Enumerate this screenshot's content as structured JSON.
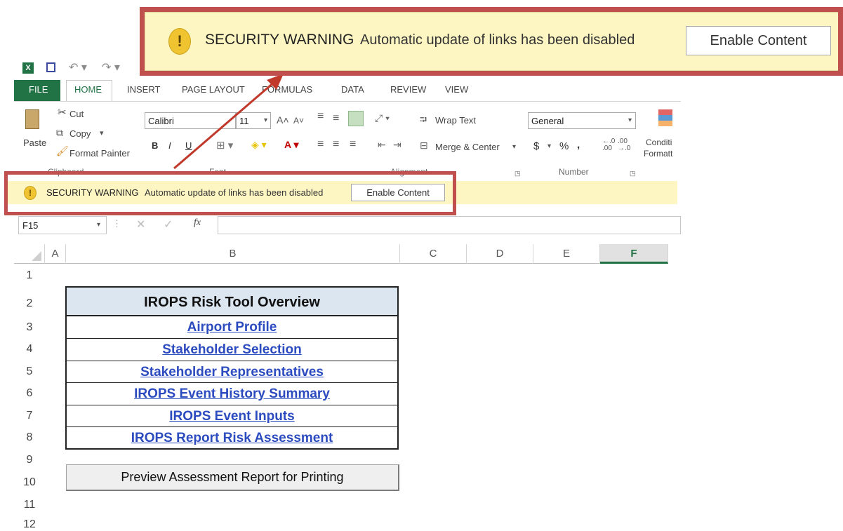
{
  "zoom_banner": {
    "title": "SECURITY WARNING",
    "message": "Automatic update of links has been disabled",
    "button": "Enable Content",
    "icon": "!"
  },
  "quick_access": {
    "undo": "↶ ▾",
    "redo": "↷ ▾"
  },
  "tabs": [
    "FILE",
    "HOME",
    "INSERT",
    "PAGE LAYOUT",
    "FORMULAS",
    "DATA",
    "REVIEW",
    "VIEW"
  ],
  "clipboard": {
    "paste": "Paste",
    "cut": "Cut",
    "copy": "Copy",
    "format_painter": "Format Painter",
    "group_label": "Clipboard"
  },
  "font": {
    "name": "Calibri",
    "size": "11",
    "bold": "B",
    "italic": "I",
    "underline": "U",
    "group_label": "Font"
  },
  "alignment": {
    "wrap_text": "Wrap Text",
    "merge_center": "Merge & Center",
    "group_label": "Alignment"
  },
  "number": {
    "format": "General",
    "currency": "$",
    "percent": "%",
    "comma": ",",
    "group_label": "Number"
  },
  "styles": {
    "conditional": "Conditi",
    "formatting": "Formatt"
  },
  "warning_bar": {
    "title": "SECURITY WARNING",
    "message": "Automatic update of links has been disabled",
    "button": "Enable Content"
  },
  "formula_bar": {
    "name_box": "F15",
    "fx": "fx",
    "value": ""
  },
  "columns": [
    "A",
    "B",
    "C",
    "D",
    "E",
    "F"
  ],
  "rows": [
    "1",
    "2",
    "3",
    "4",
    "5",
    "6",
    "7",
    "8",
    "9",
    "10",
    "11",
    "12"
  ],
  "overview": {
    "title": "IROPS Risk Tool Overview",
    "links": [
      "Airport Profile",
      "Stakeholder Selection",
      "Stakeholder Representatives",
      "IROPS Event History Summary",
      "IROPS Event Inputs",
      "IROPS Report Risk Assessment"
    ]
  },
  "preview_button": "Preview Assessment Report for Printing",
  "colors": {
    "frame": "#c0504d",
    "arrow": "#c0392b",
    "warning_bg": "#fdf6c3",
    "link": "#2b4bbf",
    "selected_col": "#217346"
  }
}
